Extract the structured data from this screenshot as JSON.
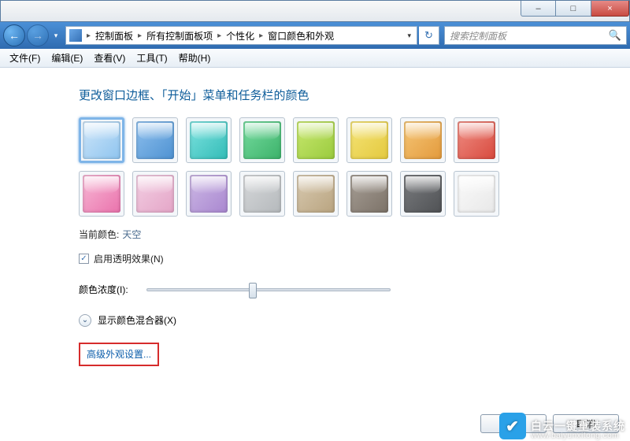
{
  "titlebar": {
    "min": "–",
    "max": "□",
    "close": "×"
  },
  "nav": {
    "back": "←",
    "fwd": "→",
    "chev": "▾",
    "crumbs": [
      "控制面板",
      "所有控制面板项",
      "个性化",
      "窗口颜色和外观"
    ],
    "dropdown": "▾",
    "refresh": "↻",
    "search_placeholder": "搜索控制面板",
    "search_icon": "🔍"
  },
  "menu": [
    "文件(F)",
    "编辑(E)",
    "查看(V)",
    "工具(T)",
    "帮助(H)"
  ],
  "heading": "更改窗口边框、「开始」菜单和任务栏的颜色",
  "colors": [
    {
      "bg": "linear-gradient(135deg,#cfe6f9,#8ec4ef)",
      "sel": true
    },
    {
      "bg": "linear-gradient(135deg,#8fc0ee,#4e92d2)"
    },
    {
      "bg": "linear-gradient(135deg,#7ee3e0,#33bcb7)"
    },
    {
      "bg": "linear-gradient(135deg,#77dca0,#3cb26a)"
    },
    {
      "bg": "linear-gradient(135deg,#c9e86f,#9acb3e)"
    },
    {
      "bg": "linear-gradient(135deg,#f5e477,#e4c93e)"
    },
    {
      "bg": "linear-gradient(135deg,#f6c778,#e39a3c)"
    },
    {
      "bg": "linear-gradient(135deg,#f08f85,#d84a3e)"
    },
    {
      "bg": "linear-gradient(135deg,#f7b9d6,#ea72ac)"
    },
    {
      "bg": "linear-gradient(135deg,#f3cfe3,#e4a5c7)"
    },
    {
      "bg": "linear-gradient(135deg,#cdb9e5,#a987d0)"
    },
    {
      "bg": "linear-gradient(135deg,#d6d8da,#b5b9bc)"
    },
    {
      "bg": "linear-gradient(135deg,#d8cab1,#b9a480)"
    },
    {
      "bg": "linear-gradient(135deg,#a79f96,#7c7268)"
    },
    {
      "bg": "linear-gradient(135deg,#7a7c7f,#505255)"
    },
    {
      "bg": "linear-gradient(135deg,#fafafa,#e8e8e8)"
    }
  ],
  "current": {
    "label": "当前颜色:",
    "value": "天空"
  },
  "transparency": {
    "checked": "✓",
    "label": "启用透明效果(N)"
  },
  "intensity": {
    "label": "颜色浓度(I):"
  },
  "mixer": {
    "icon": "⌄",
    "label": "显示颜色混合器(X)"
  },
  "advanced": "高级外观设置...",
  "buttons": {
    "ok": "确定",
    "cancel": "取消"
  },
  "watermark": {
    "icon": "✔",
    "text": "白云一键重装系统",
    "url": "www.baiyunxitong.com"
  }
}
